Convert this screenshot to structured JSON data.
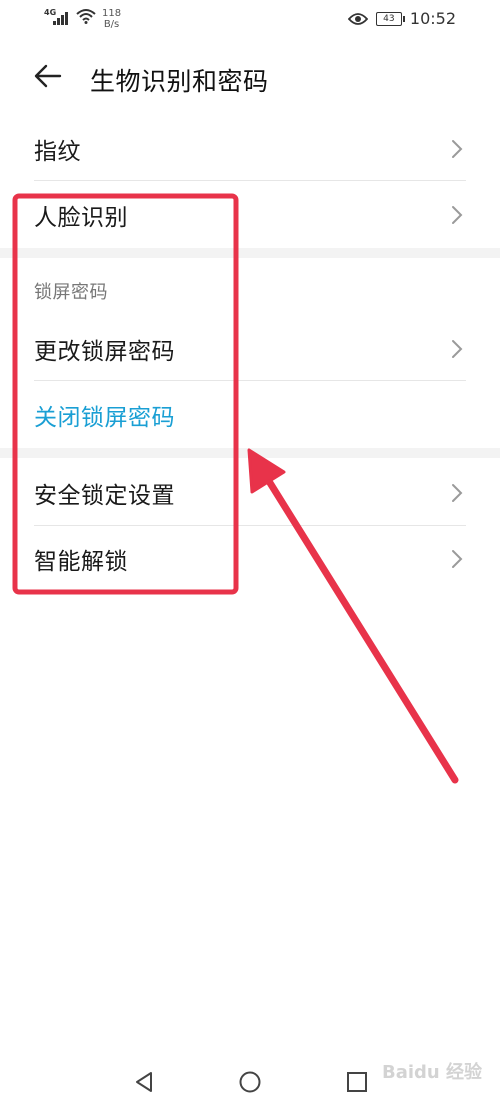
{
  "status_bar": {
    "network_type": "4G",
    "net_speed_value": "118",
    "net_speed_unit": "B/s",
    "battery": "43",
    "time": "10:52"
  },
  "header": {
    "title": "生物识别和密码"
  },
  "rows": {
    "fingerprint": "指纹",
    "face": "人脸识别",
    "section_lock": "锁屏密码",
    "change_lock": "更改锁屏密码",
    "disable_lock": "关闭锁屏密码",
    "security_lock": "安全锁定设置",
    "smart_unlock": "智能解锁"
  },
  "colors": {
    "accent": "#1a9fd4",
    "annotation": "#e8334a"
  },
  "watermark": "Baidu 经验"
}
